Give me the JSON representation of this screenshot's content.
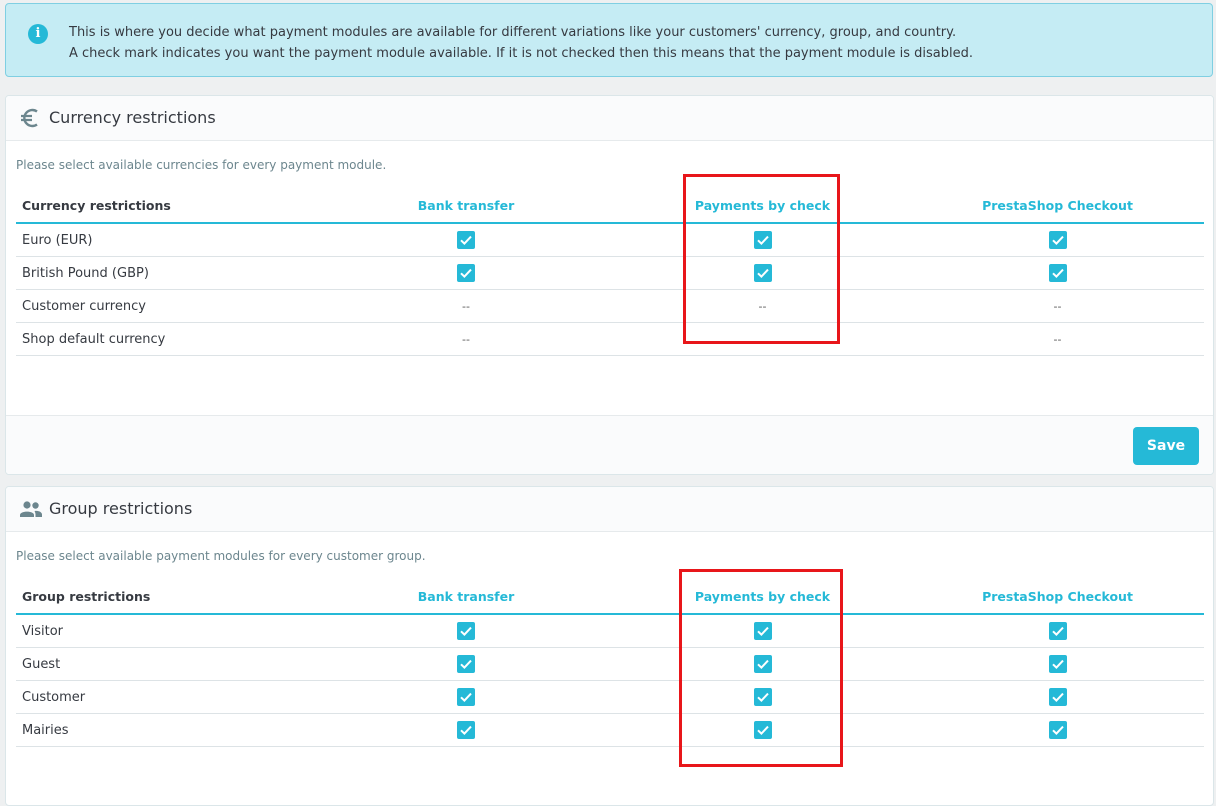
{
  "alert": {
    "line1": "This is where you decide what payment modules are available for different variations like your customers' currency, group, and country.",
    "line2": "A check mark indicates you want the payment module available. If it is not checked then this means that the payment module is disabled."
  },
  "currency": {
    "title": "Currency restrictions",
    "description": "Please select available currencies for every payment module.",
    "columns": [
      "Currency restrictions",
      "Bank transfer",
      "Payments by check",
      "PrestaShop Checkout"
    ],
    "rows": [
      {
        "label": "Euro (EUR)",
        "cells": [
          "check",
          "check",
          "check"
        ]
      },
      {
        "label": "British Pound (GBP)",
        "cells": [
          "check",
          "check",
          "check"
        ]
      },
      {
        "label": "Customer currency",
        "cells": [
          "--",
          "--",
          "--"
        ]
      },
      {
        "label": "Shop default currency",
        "cells": [
          "--",
          "",
          "--"
        ]
      }
    ],
    "save_label": "Save"
  },
  "group": {
    "title": "Group restrictions",
    "description": "Please select available payment modules for every customer group.",
    "columns": [
      "Group restrictions",
      "Bank transfer",
      "Payments by check",
      "PrestaShop Checkout"
    ],
    "rows": [
      {
        "label": "Visitor",
        "cells": [
          "check",
          "check",
          "check"
        ]
      },
      {
        "label": "Guest",
        "cells": [
          "check",
          "check",
          "check"
        ]
      },
      {
        "label": "Customer",
        "cells": [
          "check",
          "check",
          "check"
        ]
      },
      {
        "label": "Mairies",
        "cells": [
          "check",
          "check",
          "check"
        ]
      }
    ]
  },
  "icons": {
    "alert": "info-icon",
    "currency": "euro-icon",
    "group": "people-icon",
    "checkbox": "checkbox-checked-icon"
  },
  "colors": {
    "accent": "#25b9d7",
    "highlight": "#e8161a",
    "alert_bg": "#c5ecf4"
  }
}
